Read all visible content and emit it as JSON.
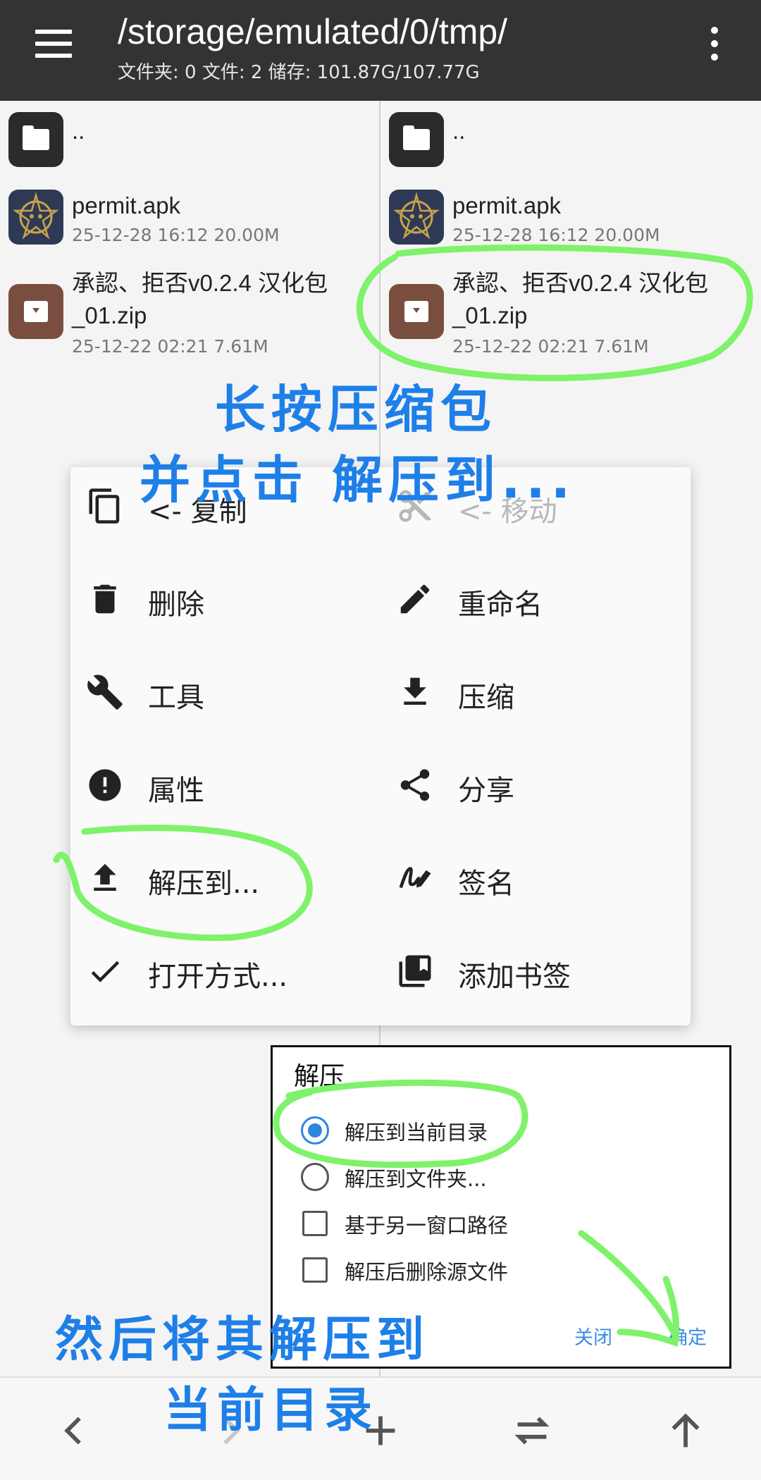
{
  "header": {
    "path": "/storage/emulated/0/tmp/",
    "stats": "文件夹: 0  文件: 2  储存: 101.87G/107.77G"
  },
  "files": {
    "parent": "..",
    "apk": {
      "name": "permit.apk",
      "meta": "25-12-28 16:12  20.00M"
    },
    "zip": {
      "name_line1": "承認、拒否v0.2.4 汉化包",
      "name_line2": "_01.zip",
      "meta": "25-12-22 02:21  7.61M"
    }
  },
  "context_menu": {
    "copy": "<- 复制",
    "move": "<- 移动",
    "delete": "删除",
    "rename": "重命名",
    "tools": "工具",
    "compress": "压缩",
    "properties": "属性",
    "share": "分享",
    "extract_to": "解压到...",
    "sign": "签名",
    "open_with": "打开方式...",
    "bookmark": "添加书签"
  },
  "dialog": {
    "title": "解压",
    "option_current_dir": "解压到当前目录",
    "option_folder": "解压到文件夹...",
    "option_other_pane": "基于另一窗口路径",
    "option_delete_source": "解压后删除源文件",
    "close": "关闭",
    "ok": "确定",
    "selected": "解压到当前目录"
  },
  "annotations": {
    "line1": "长按压缩包",
    "line2": "并点击 解压到...",
    "line3": "然后将其解压到",
    "line4": "当前目录"
  },
  "colors": {
    "header_bg": "#333333",
    "accent": "#2e86de",
    "annotation_text": "#1e7fe8",
    "annotation_circle": "#7ef26a"
  },
  "icons": [
    "menu-icon",
    "more-vert-icon",
    "folder-icon",
    "apk-icon",
    "archive-icon",
    "copy-icon",
    "cut-icon",
    "delete-icon",
    "edit-icon",
    "wrench-icon",
    "download-icon",
    "info-icon",
    "share-icon",
    "upload-icon",
    "signature-icon",
    "check-icon",
    "bookmark-icon",
    "back-icon",
    "forward-icon",
    "add-icon",
    "swap-icon",
    "up-icon"
  ]
}
